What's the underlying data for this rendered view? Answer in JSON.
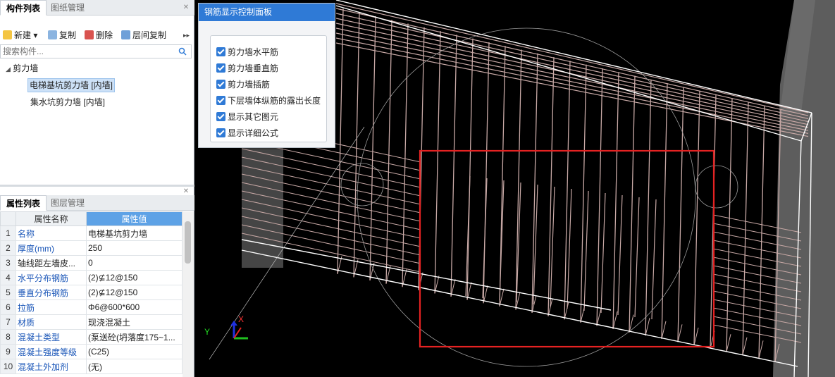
{
  "top_tabs": {
    "active": "构件列表",
    "inactive": "图纸管理"
  },
  "toolbar": {
    "new": "新建",
    "copy": "复制",
    "delete": "删除",
    "floor_copy": "层间复制",
    "more": "▸▸"
  },
  "search": {
    "placeholder": "搜索构件..."
  },
  "tree": {
    "group": "剪力墙",
    "items": [
      "电梯基坑剪力墙 [内墙]",
      "集水坑剪力墙 [内墙]"
    ]
  },
  "bottom_tabs": {
    "active": "属性列表",
    "inactive": "图层管理"
  },
  "props": {
    "col_name": "属性名称",
    "col_value": "属性值",
    "rows": [
      {
        "n": "1",
        "name": "名称",
        "value": "电梯基坑剪力墙"
      },
      {
        "n": "2",
        "name": "厚度(mm)",
        "value": "250"
      },
      {
        "n": "3",
        "name": "轴线距左墙皮...",
        "value": "0"
      },
      {
        "n": "4",
        "name": "水平分布钢筋",
        "value": "(2)⊈12@150"
      },
      {
        "n": "5",
        "name": "垂直分布钢筋",
        "value": "(2)⊈12@150"
      },
      {
        "n": "6",
        "name": "拉筋",
        "value": "Φ6@600*600"
      },
      {
        "n": "7",
        "name": "材质",
        "value": "现浇混凝土"
      },
      {
        "n": "8",
        "name": "混凝土类型",
        "value": "(泵送砼(坍落度175~1..."
      },
      {
        "n": "9",
        "name": "混凝土强度等级",
        "value": "(C25)"
      },
      {
        "n": "10",
        "name": "混凝土外加剂",
        "value": "(无)"
      }
    ]
  },
  "control_panel": {
    "title": "钢筋显示控制面板",
    "options": [
      "剪力墙水平筋",
      "剪力墙垂直筋",
      "剪力墙插筋",
      "下层墙体纵筋的露出长度",
      "显示其它图元",
      "显示详细公式"
    ]
  },
  "axes": {
    "x": "X",
    "y": "Y"
  },
  "colors": {
    "accent": "#2f7ad6",
    "header_value": "#5ea2e6",
    "highlight_box": "#e52222",
    "rebar": "#c8a9a6"
  }
}
